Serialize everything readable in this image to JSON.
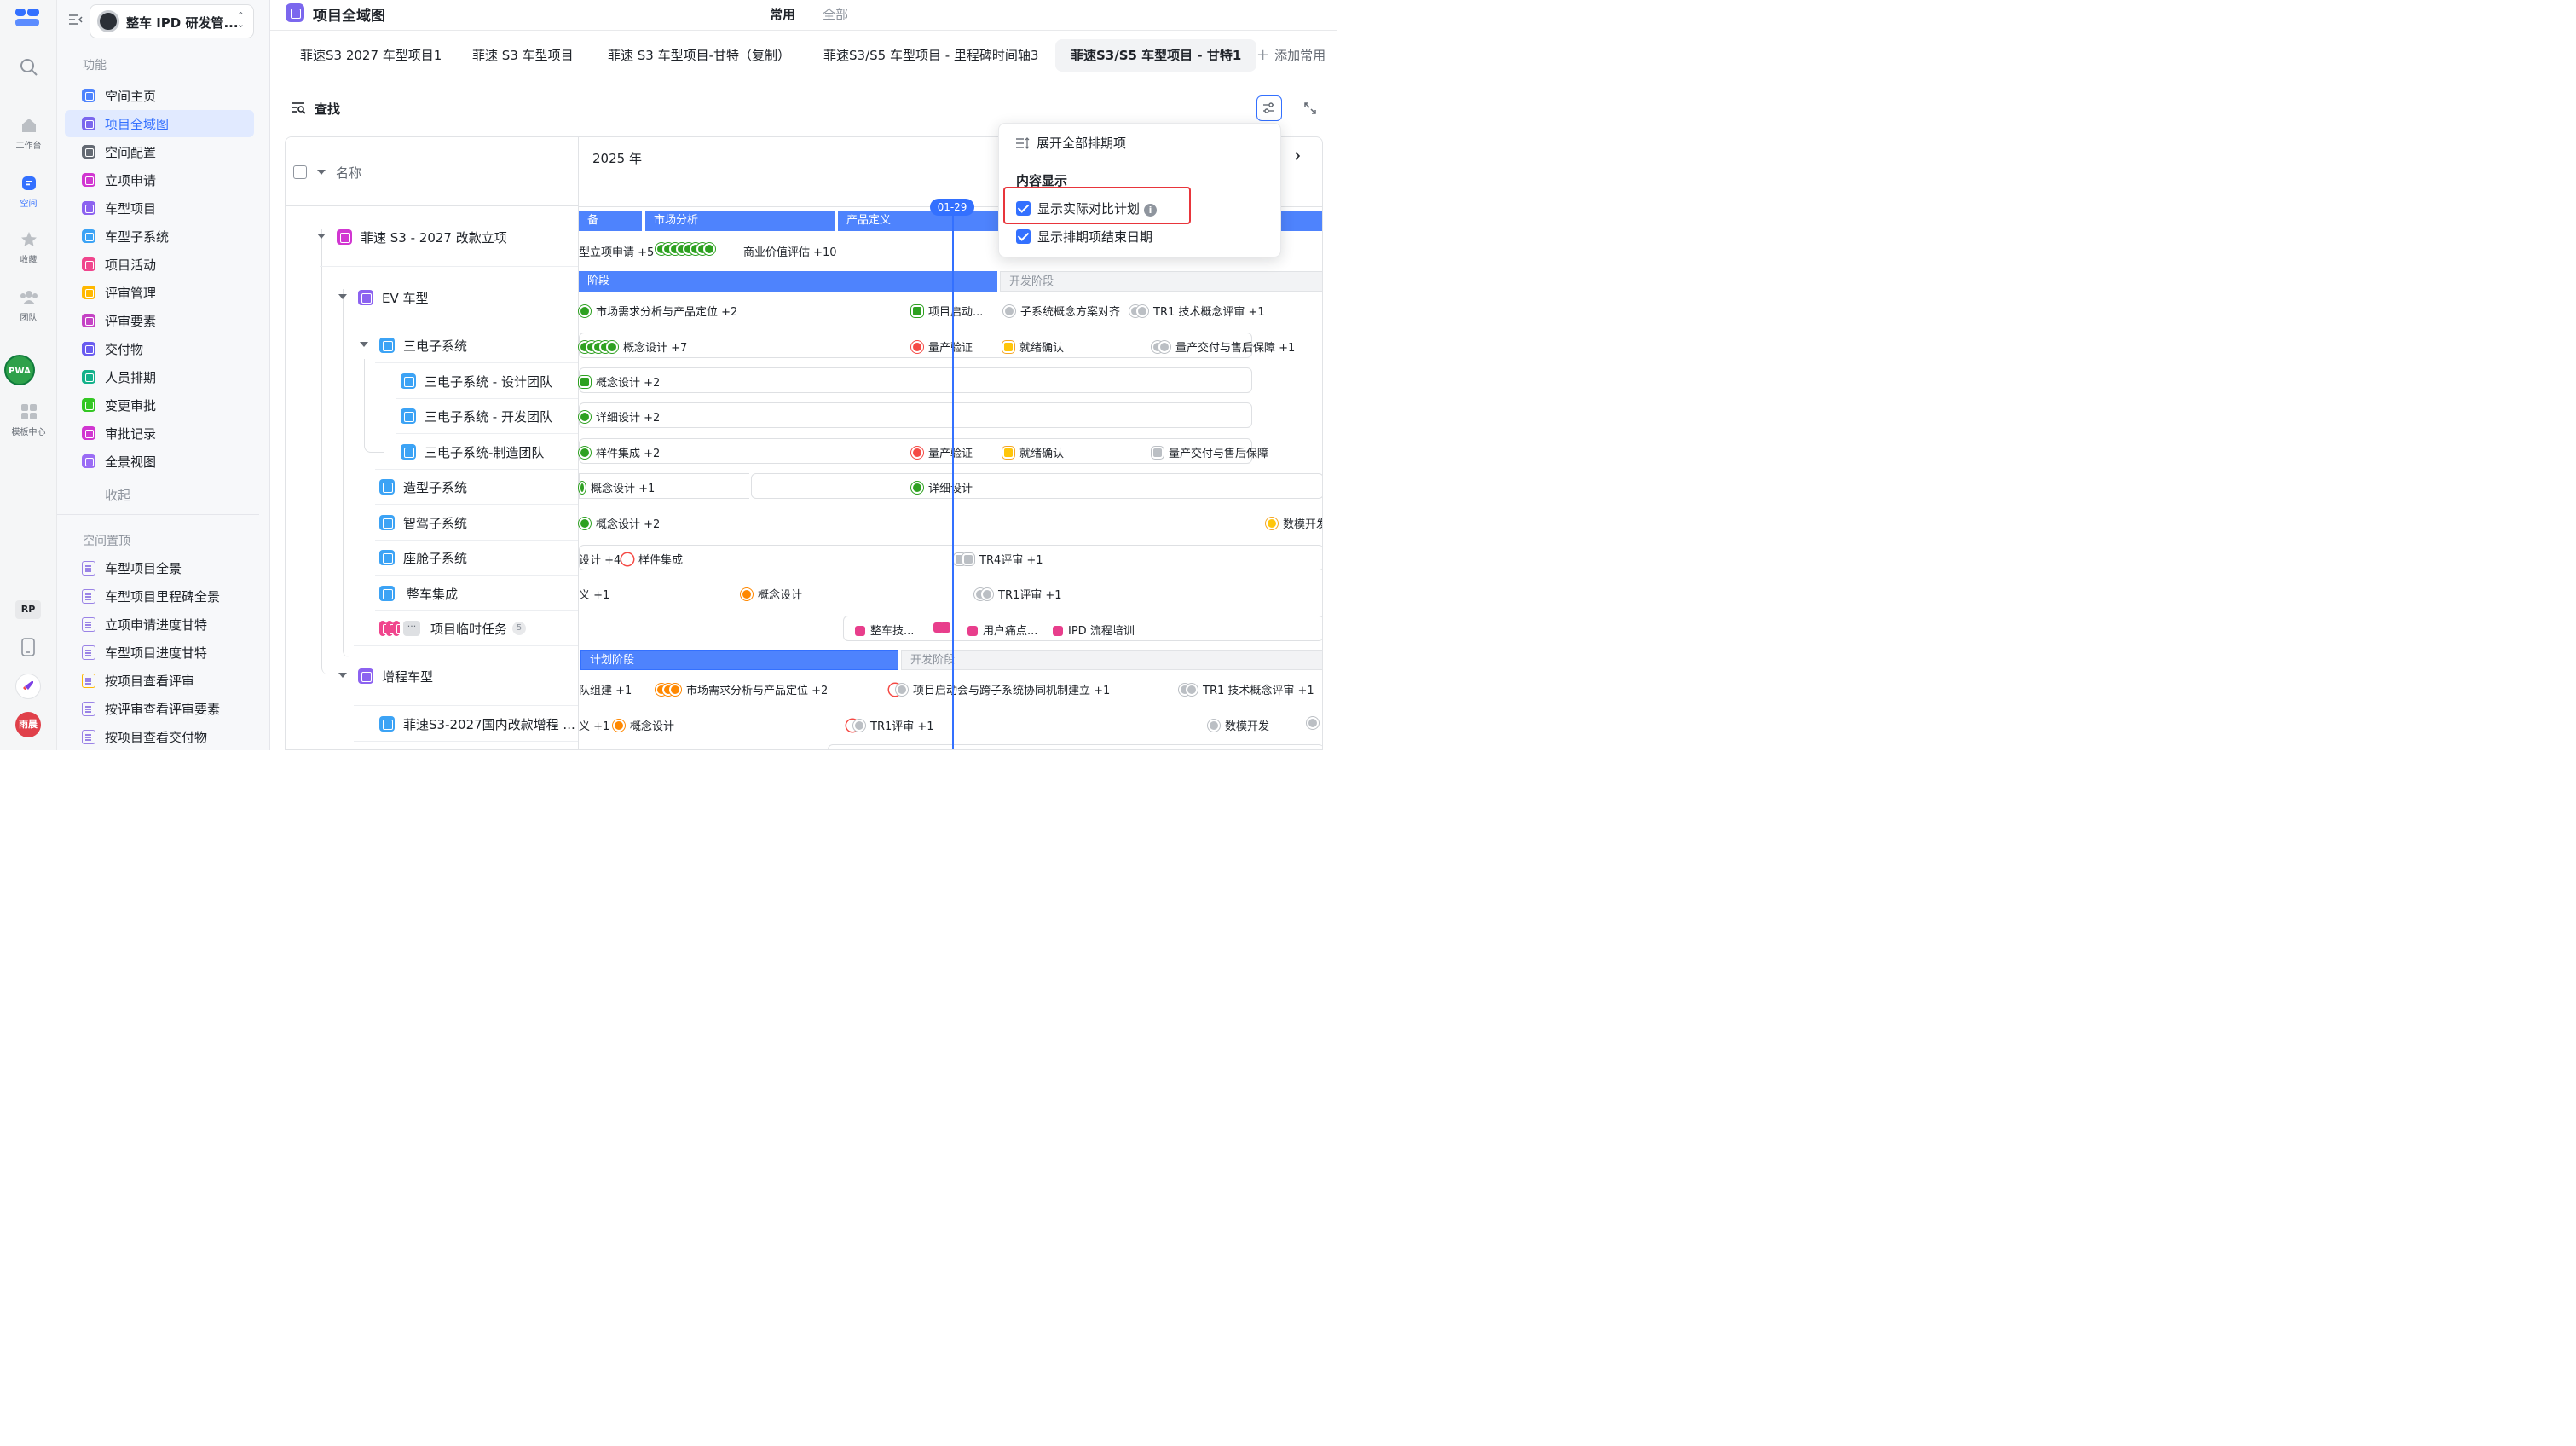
{
  "rail": {
    "items": [
      {
        "label": ""
      },
      {
        "label": "工作台"
      },
      {
        "label": "空间"
      },
      {
        "label": "收藏"
      },
      {
        "label": "团队"
      },
      {
        "label": "模板中心"
      }
    ],
    "badge_rp": "RP",
    "user_avatar": "雨晨",
    "team_avatar": "PWA"
  },
  "sidebar": {
    "workspace_name": "整车 IPD 研发管...",
    "section_function": "功能",
    "items": [
      {
        "label": "空间主页",
        "color": "#4e83fd"
      },
      {
        "label": "项目全域图",
        "color": "#7b67ee"
      },
      {
        "label": "空间配置",
        "color": "#646a73"
      },
      {
        "label": "立项申请",
        "color": "#d136d1"
      },
      {
        "label": "车型项目",
        "color": "#8c62f0"
      },
      {
        "label": "车型子系统",
        "color": "#3ca3f5"
      },
      {
        "label": "项目活动",
        "color": "#f0458d"
      },
      {
        "label": "评审管理",
        "color": "#ffb800"
      },
      {
        "label": "评审要素",
        "color": "#c543c5"
      },
      {
        "label": "交付物",
        "color": "#6a5cf0"
      },
      {
        "label": "人员排期",
        "color": "#14b28b"
      },
      {
        "label": "变更审批",
        "color": "#34c724"
      },
      {
        "label": "审批记录",
        "color": "#d136d1"
      },
      {
        "label": "全景视图",
        "color": "#9a6cf5"
      }
    ],
    "collapse": "收起",
    "section_pinned": "空间置顶",
    "pinned": [
      {
        "label": "车型项目全景"
      },
      {
        "label": "车型项目里程碑全景"
      },
      {
        "label": "立项申请进度甘特"
      },
      {
        "label": "车型项目进度甘特"
      },
      {
        "label": "按项目查看评审"
      },
      {
        "label": "按评审查看评审要素"
      },
      {
        "label": "按项目查看交付物"
      }
    ]
  },
  "header": {
    "title": "项目全域图",
    "view_common": "常用",
    "view_all": "全部"
  },
  "tabs": [
    {
      "label": "菲速S3 2027 车型项目1"
    },
    {
      "label": "菲速 S3 车型项目"
    },
    {
      "label": "菲速 S3 车型项目-甘特（复制）"
    },
    {
      "label": "菲速S3/S5 车型项目 - 里程碑时间轴3"
    },
    {
      "label": "菲速S3/S5 车型项目 - 甘特1"
    }
  ],
  "add_common": "添加常用",
  "toolbar": {
    "find": "查找"
  },
  "grid": {
    "name_header": "名称",
    "year": "2025 年",
    "today": "01-29",
    "rows": [
      {
        "label": "菲速 S3 - 2027 改款立项"
      },
      {
        "label": "EV 车型"
      },
      {
        "label": "三电子系统"
      },
      {
        "label": "三电子系统 - 设计团队"
      },
      {
        "label": "三电子系统 - 开发团队"
      },
      {
        "label": "三电子系统-制造团队"
      },
      {
        "label": "造型子系统"
      },
      {
        "label": "智驾子系统"
      },
      {
        "label": "座舱子系统"
      },
      {
        "label": "整车集成"
      },
      {
        "label": "项目临时任务",
        "count": "5"
      },
      {
        "label": "增程车型"
      },
      {
        "label": "菲速S3-2027国内改款增程 ..."
      }
    ],
    "bars": {
      "r0_a": "备",
      "r0_b": "市场分析",
      "r0_c": "产品定义",
      "r1_a": "阶段",
      "r1_b": "开发阶段",
      "r11_a": "计划阶段",
      "r11_b": "开发阶段"
    },
    "milestones": {
      "r0_1": "型立项申请 +5",
      "r0_2": "商业价值评估 +10",
      "r1_1": "市场需求分析与产品定位  +2",
      "r1_2": "项目启动...",
      "r1_3": "子系统概念方案对齐",
      "r1_4": "TR1 技术概念评审 +1",
      "r2_1": "概念设计 +7",
      "r2_2": "量产验证",
      "r2_3": "就绪确认",
      "r2_4": "量产交付与售后保障 +1",
      "r3_1": "概念设计 +2",
      "r4_1": "详细设计 +2",
      "r5_1": "样件集成 +2",
      "r5_2": "量产验证",
      "r5_3": "就绪确认",
      "r5_4": "量产交付与售后保障",
      "r6_1": "概念设计 +1",
      "r6_2": "详细设计",
      "r7_1": "概念设计 +2",
      "r7_2": "数模开发",
      "r8_1": "设计 +4",
      "r8_2": "样件集成",
      "r8_3": "TR4评审 +1",
      "r9_1": "义 +1",
      "r9_2": "概念设计",
      "r9_3": "TR1评审 +1",
      "r10_1": "整车技...",
      "r10_2": "用户痛点...",
      "r10_3": "IPD 流程培训",
      "r11_1": "队组建 +1",
      "r11_2": "市场需求分析与产品定位  +2",
      "r11_3": "项目启动会与跨子系统协同机制建立 +1",
      "r11_4": "TR1 技术概念评审 +1",
      "r12_1": "义 +1",
      "r12_2": "概念设计",
      "r12_3": "TR1评审 +1",
      "r12_4": "数模开发"
    }
  },
  "popover": {
    "expand_all": "展开全部排期项",
    "content_title": "内容显示",
    "opt_actual": "显示实际对比计划",
    "opt_end": "显示排期项结束日期",
    "info": "i"
  },
  "colors": {
    "accent": "#3370ff",
    "highlight": "#e8353b"
  }
}
